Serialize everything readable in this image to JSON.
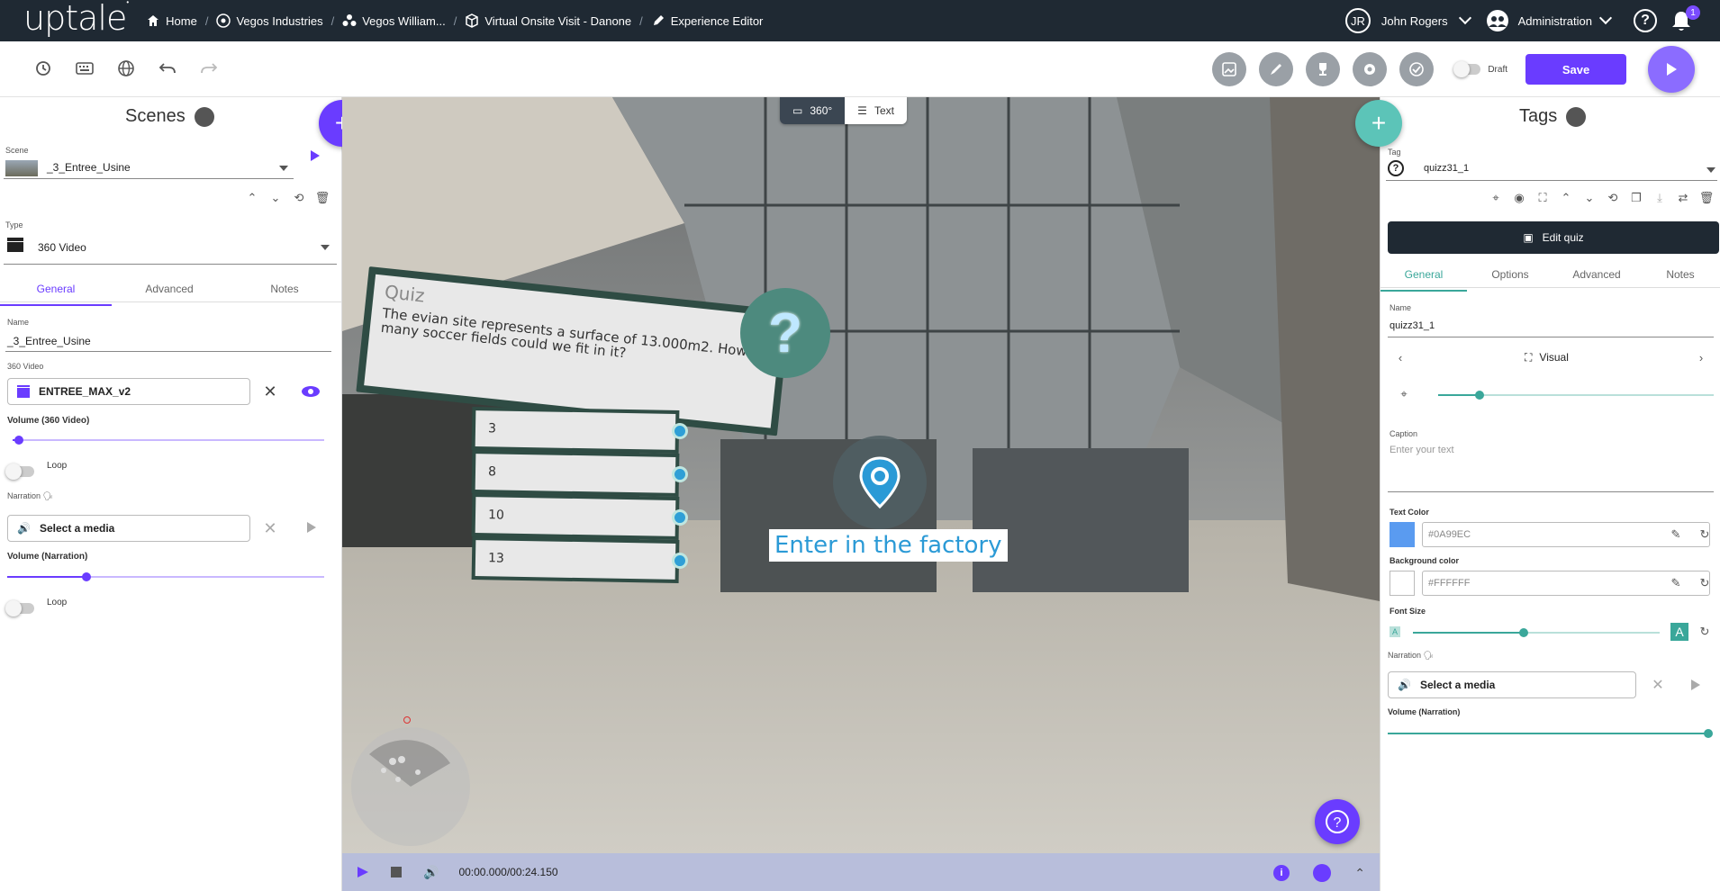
{
  "header": {
    "logo": "uptale",
    "breadcrumbs": [
      {
        "label": "Home",
        "icon": "home-icon"
      },
      {
        "label": "Vegos Industries",
        "icon": "company-icon"
      },
      {
        "label": "Vegos William...",
        "icon": "group-icon"
      },
      {
        "label": "Virtual Onsite Visit - Danone",
        "icon": "cube-icon"
      },
      {
        "label": "Experience Editor",
        "icon": "pencil-icon"
      }
    ],
    "user_initials": "JR",
    "user_name": "John Rogers",
    "admin_label": "Administration",
    "notifications_count": "1"
  },
  "toolbar": {
    "left_icons": [
      "history-icon",
      "keyboard-icon",
      "globe-icon",
      "undo-icon",
      "redo-icon"
    ],
    "right_icons": [
      "image-icon",
      "brush-icon",
      "trophy-icon",
      "settings-icon",
      "check-icon"
    ],
    "draft_label": "Draft",
    "save_label": "Save"
  },
  "scenes_panel": {
    "title": "Scenes",
    "scene_label": "Scene",
    "scene_value": "_3_Entree_Usine",
    "type_label": "Type",
    "type_value": "360 Video",
    "tabs": [
      "General",
      "Advanced",
      "Notes"
    ],
    "name_label": "Name",
    "name_value": "_3_Entree_Usine",
    "video_label": "360 Video",
    "video_value": "ENTREE_MAX_v2",
    "volume_video_label": "Volume (360 Video)",
    "volume_video_level": 0.02,
    "loop_label": "Loop",
    "narration_label": "Narration",
    "narration_value": "Select a media",
    "volume_narration_label": "Volume (Narration)",
    "volume_narration_level": 0.25,
    "loop2_label": "Loop"
  },
  "viewer": {
    "mode_360": "360°",
    "mode_text": "Text",
    "quiz_title": "Quiz",
    "quiz_question": "The evian site represents a surface of 13.000m2. How many soccer fields could we fit in it?",
    "answers": [
      "3",
      "8",
      "10",
      "13"
    ],
    "tag_caption": "Enter in the factory",
    "time": "00:00.000/00:24.150"
  },
  "tags_panel": {
    "title": "Tags",
    "tag_label": "Tag",
    "tag_value": "quizz31_1",
    "edit_quiz_label": "Edit quiz",
    "tabs": [
      "General",
      "Options",
      "Advanced",
      "Notes"
    ],
    "name_label": "Name",
    "name_value": "quizz31_1",
    "visual_label": "Visual",
    "visual_slider_level": 0.15,
    "caption_label": "Caption",
    "caption_placeholder": "Enter your text",
    "text_color_label": "Text Color",
    "text_color_value": "#0A99EC",
    "bg_color_label": "Background color",
    "bg_color_value": "#FFFFFF",
    "font_size_label": "Font Size",
    "font_size_level": 0.45,
    "narration_label": "Narration",
    "narration_value": "Select a media",
    "volume_narration_label": "Volume (Narration)",
    "volume_narration_level": 1.0
  },
  "colors": {
    "accent": "#6A3CFF",
    "teal": "#3AA79A",
    "topbar": "#1F2933",
    "text_color_swatch": "#5A9BF0"
  }
}
